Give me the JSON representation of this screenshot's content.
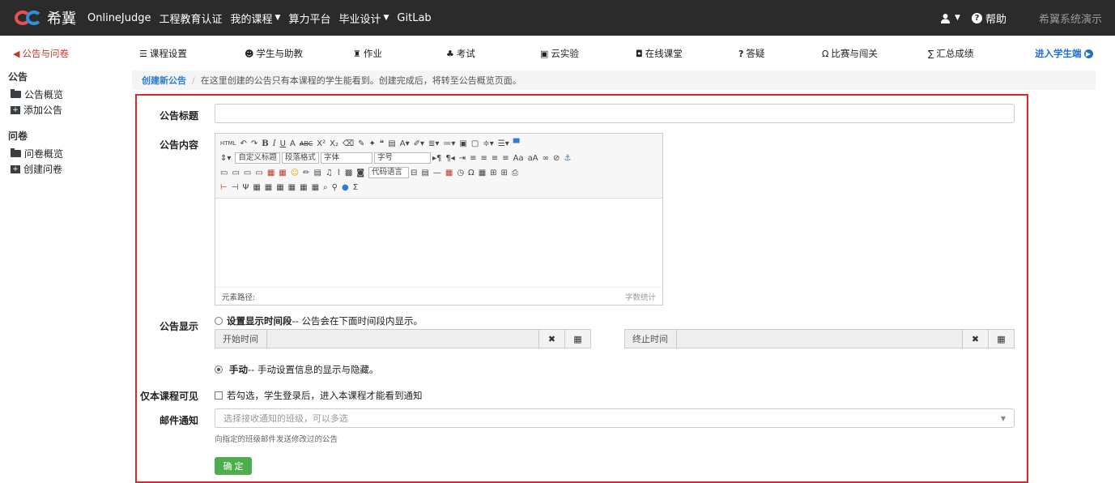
{
  "brand": {
    "name": "希冀"
  },
  "topnav": [
    {
      "label": "OnlineJudge",
      "caret": false
    },
    {
      "label": "工程教育认证",
      "caret": false
    },
    {
      "label": "我的课程",
      "caret": true
    },
    {
      "label": "算力平台",
      "caret": false
    },
    {
      "label": "毕业设计",
      "caret": true
    },
    {
      "label": "GitLab",
      "caret": false
    }
  ],
  "top_right": {
    "help": "帮助",
    "demo": "希翼系统演示"
  },
  "subnav": [
    {
      "label": "公告与问卷",
      "icon": "megaphone-icon",
      "glyph": "◀"
    },
    {
      "label": "课程设置",
      "icon": "list-icon",
      "glyph": "☰"
    },
    {
      "label": "学生与助教",
      "icon": "users-icon",
      "glyph": "👥"
    },
    {
      "label": "作业",
      "icon": "work-icon",
      "glyph": "♟"
    },
    {
      "label": "考试",
      "icon": "exam-icon",
      "glyph": "♣"
    },
    {
      "label": "云实验",
      "icon": "monitor-icon",
      "glyph": "▣"
    },
    {
      "label": "在线课堂",
      "icon": "classroom-icon",
      "glyph": "◘"
    },
    {
      "label": "答疑",
      "icon": "question-icon",
      "glyph": "?"
    },
    {
      "label": "比赛与闯关",
      "icon": "trophy-icon",
      "glyph": "Ω"
    },
    {
      "label": "汇总成绩",
      "icon": "sigma-icon",
      "glyph": "∑"
    }
  ],
  "student_link": "进入学生端",
  "sidebar": {
    "sections": [
      {
        "title": "公告",
        "items": [
          {
            "label": "公告概览",
            "icon": "folder-icon"
          },
          {
            "label": "添加公告",
            "icon": "add-icon"
          }
        ]
      },
      {
        "title": "问卷",
        "items": [
          {
            "label": "问卷概览",
            "icon": "folder-icon"
          },
          {
            "label": "创建问卷",
            "icon": "add-icon"
          }
        ]
      }
    ]
  },
  "breadcrumb": {
    "link": "创建新公告",
    "sep": "/",
    "note": "在这里创建的公告只有本课程的学生能看到。创建完成后，将转至公告概览页面。"
  },
  "form": {
    "title_label": "公告标题",
    "content_label": "公告内容",
    "editor": {
      "font_family_select": "自定义标题",
      "paragraph_select": "段落格式",
      "font_select": "字体",
      "size_select": "字号",
      "code_select": "代码语言",
      "path_label": "元素路径:",
      "wordcount": "字数统计"
    },
    "display_label": "公告显示",
    "option_period": {
      "bold": "设置显示时间段",
      "rest": " -- 公告会在下面时间段内显示。"
    },
    "start_time": "开始时间",
    "end_time": "终止时间",
    "option_manual": {
      "bold": "手动",
      "rest": " -- 手动设置信息的显示与隐藏。"
    },
    "visible_label": "仅本课程可见",
    "visible_text": "若勾选，学生登录后，进入本课程才能看到通知",
    "email_label": "邮件通知",
    "email_placeholder": "选择接收通知的班级，可以多选",
    "email_help": "向指定的班级邮件发送修改过的公告",
    "submit": "确 定"
  }
}
